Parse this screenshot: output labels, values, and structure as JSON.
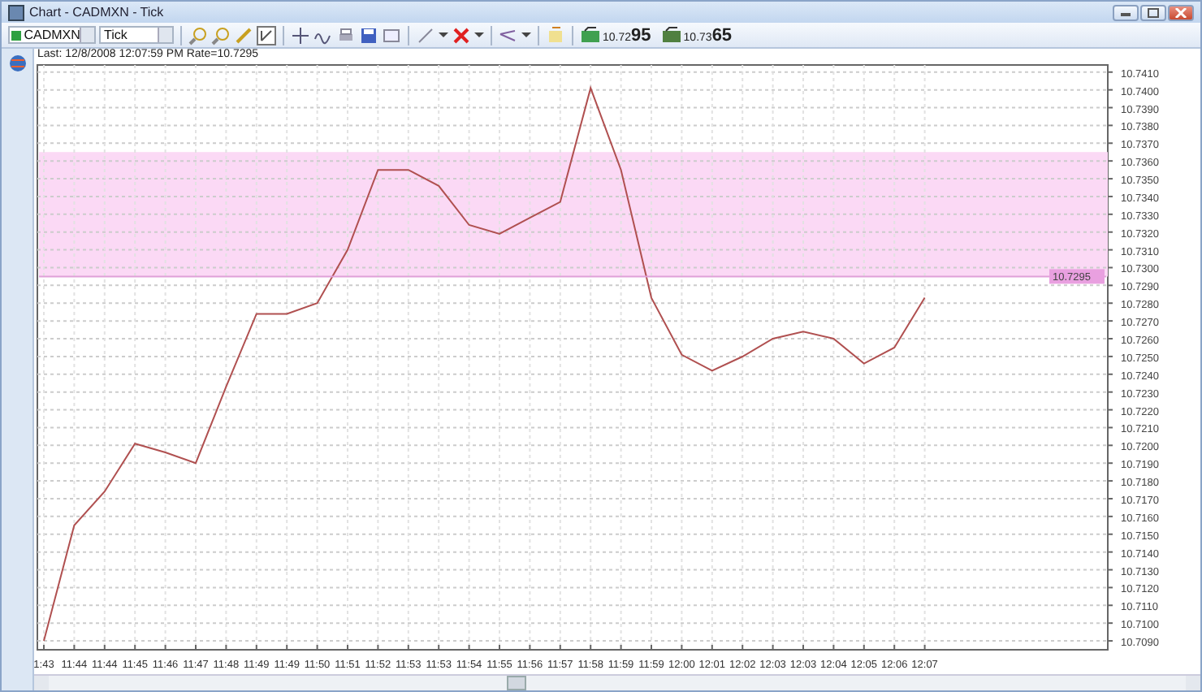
{
  "window": {
    "title": "Chart - CADMXN - Tick"
  },
  "toolbar": {
    "symbol": "CADMXN",
    "interval": "Tick",
    "sell_price": "10.72**95**",
    "buy_price": "10.73**65**"
  },
  "info_line": "Last: 12/8/2008 12:07:59 PM Rate=10.7295",
  "chart": {
    "chart_data": {
      "type": "line",
      "categories": [
        "1:43",
        "11:44",
        "11:44",
        "11:45",
        "11:46",
        "11:47",
        "11:48",
        "11:49",
        "11:49",
        "11:50",
        "11:51",
        "11:52",
        "11:53",
        "11:53",
        "11:54",
        "11:55",
        "11:56",
        "11:57",
        "11:58",
        "11:59",
        "11:59",
        "12:00",
        "12:01",
        "12:02",
        "12:03",
        "12:03",
        "12:04",
        "12:05",
        "12:06",
        "12:07"
      ],
      "grid": true,
      "series": [
        {
          "color": "#b05050",
          "values": [
            10.709,
            10.7155,
            10.7174,
            10.7201,
            10.7196,
            10.719,
            10.7233,
            10.7274,
            10.7274,
            10.728,
            10.731,
            10.7355,
            10.7355,
            10.7346,
            10.7324,
            10.7319,
            10.7328,
            10.7337,
            10.7401,
            10.7355,
            10.7283,
            10.7251,
            10.7242,
            10.725,
            10.726,
            10.7264,
            10.726,
            10.7246,
            10.7255,
            10.7283
          ]
        }
      ],
      "ylim": [
        10.7085,
        10.7414
      ],
      "yticks": [
        {
          "value": 10.709,
          "label": "10.7090"
        },
        {
          "value": 10.71,
          "label": "10.7100"
        },
        {
          "value": 10.711,
          "label": "10.7110"
        },
        {
          "value": 10.712,
          "label": "10.7120"
        },
        {
          "value": 10.713,
          "label": "10.7130"
        },
        {
          "value": 10.714,
          "label": "10.7140"
        },
        {
          "value": 10.715,
          "label": "10.7150"
        },
        {
          "value": 10.716,
          "label": "10.7160"
        },
        {
          "value": 10.717,
          "label": "10.7170"
        },
        {
          "value": 10.718,
          "label": "10.7180"
        },
        {
          "value": 10.719,
          "label": "10.7190"
        },
        {
          "value": 10.72,
          "label": "10.7200"
        },
        {
          "value": 10.721,
          "label": "10.7210"
        },
        {
          "value": 10.722,
          "label": "10.7220"
        },
        {
          "value": 10.723,
          "label": "10.7230"
        },
        {
          "value": 10.724,
          "label": "10.7240"
        },
        {
          "value": 10.725,
          "label": "10.7250"
        },
        {
          "value": 10.726,
          "label": "10.7260"
        },
        {
          "value": 10.727,
          "label": "10.7270"
        },
        {
          "value": 10.728,
          "label": "10.7280"
        },
        {
          "value": 10.729,
          "label": "10.7290"
        },
        {
          "value": 10.73,
          "label": "10.7300"
        },
        {
          "value": 10.731,
          "label": "10.7310"
        },
        {
          "value": 10.732,
          "label": "10.7320"
        },
        {
          "value": 10.733,
          "label": "10.7330"
        },
        {
          "value": 10.734,
          "label": "10.7340"
        },
        {
          "value": 10.735,
          "label": "10.7350"
        },
        {
          "value": 10.736,
          "label": "10.7360"
        },
        {
          "value": 10.737,
          "label": "10.7370"
        },
        {
          "value": 10.738,
          "label": "10.7380"
        },
        {
          "value": 10.739,
          "label": "10.7390"
        },
        {
          "value": 10.74,
          "label": "10.7400"
        },
        {
          "value": 10.741,
          "label": "10.7410"
        }
      ],
      "bands": [
        {
          "axis": "y",
          "from": 10.7295,
          "to": 10.7365
        }
      ],
      "ref_lines": [
        {
          "axis": "y",
          "value": 10.7295,
          "label": "10.7295"
        }
      ]
    }
  }
}
